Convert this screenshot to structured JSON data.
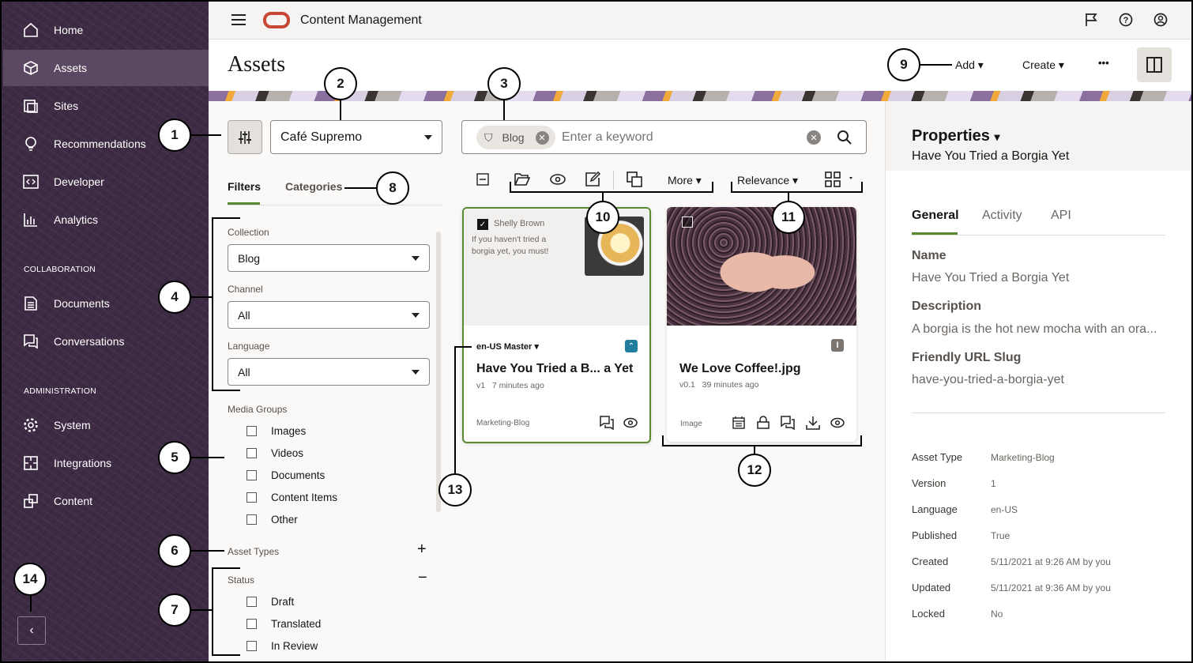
{
  "sidebar": {
    "items": [
      {
        "label": "Home",
        "icon": "home-icon"
      },
      {
        "label": "Assets",
        "icon": "cube-icon"
      },
      {
        "label": "Sites",
        "icon": "sites-icon"
      },
      {
        "label": "Recommendations",
        "icon": "lightbulb-icon"
      },
      {
        "label": "Developer",
        "icon": "code-icon"
      },
      {
        "label": "Analytics",
        "icon": "chart-icon"
      },
      {
        "label": "Documents",
        "icon": "document-icon"
      },
      {
        "label": "Conversations",
        "icon": "chat-icon"
      },
      {
        "label": "System",
        "icon": "gear-icon"
      },
      {
        "label": "Integrations",
        "icon": "puzzle-icon"
      },
      {
        "label": "Content",
        "icon": "content-icon"
      }
    ],
    "sections": [
      "COLLABORATION",
      "ADMINISTRATION"
    ],
    "collapse": "‹"
  },
  "topbar": {
    "app_title": "Content Management"
  },
  "header": {
    "title": "Assets",
    "add": "Add",
    "create": "Create",
    "more": "•••"
  },
  "filters": {
    "repository": "Café Supremo",
    "tabs": [
      "Filters",
      "Categories"
    ],
    "collection_label": "Collection",
    "collection": "Blog",
    "channel_label": "Channel",
    "channel": "All",
    "language_label": "Language",
    "language": "All",
    "media_label": "Media Groups",
    "media": [
      "Images",
      "Videos",
      "Documents",
      "Content Items",
      "Other"
    ],
    "asset_types": "Asset Types",
    "status_label": "Status",
    "status": [
      "Draft",
      "Translated",
      "In Review"
    ]
  },
  "search": {
    "chip": "Blog",
    "placeholder": "Enter a keyword"
  },
  "toolbar": {
    "more": "More",
    "sort": "Relevance"
  },
  "cards": [
    {
      "author": "Shelly Brown",
      "snippet": "If you haven't tried a borgia yet, you must!",
      "language": "en-US Master",
      "title": "Have You Tried a B... a Yet",
      "version": "v1",
      "time": "7 minutes ago",
      "type": "Marketing-Blog"
    },
    {
      "title": "We Love Coffee!.jpg",
      "version": "v0.1",
      "time": "39 minutes ago",
      "type": "Image"
    }
  ],
  "properties": {
    "heading": "Properties",
    "subtitle": "Have You Tried a Borgia Yet",
    "tabs": [
      "General",
      "Activity",
      "API"
    ],
    "name_label": "Name",
    "name": "Have You Tried a Borgia Yet",
    "desc_label": "Description",
    "desc": "A borgia is the hot new mocha with an ora...",
    "slug_label": "Friendly URL Slug",
    "slug": "have-you-tried-a-borgia-yet",
    "details": [
      {
        "k": "Asset Type",
        "v": "Marketing-Blog"
      },
      {
        "k": "Version",
        "v": "1"
      },
      {
        "k": "Language",
        "v": "en-US"
      },
      {
        "k": "Published",
        "v": "True"
      },
      {
        "k": "Created",
        "v": "5/11/2021 at 9:26 AM by you"
      },
      {
        "k": "Updated",
        "v": "5/11/2021 at 9:36 AM by you"
      },
      {
        "k": "Locked",
        "v": "No"
      }
    ]
  },
  "callouts": [
    "1",
    "2",
    "3",
    "4",
    "5",
    "6",
    "7",
    "8",
    "9",
    "10",
    "11",
    "12",
    "13",
    "14"
  ],
  "colors": {
    "sidebar": "#3d2b44",
    "accent_green": "#5a8a2f",
    "oracle_red": "#c74634",
    "teal": "#227e9e"
  }
}
